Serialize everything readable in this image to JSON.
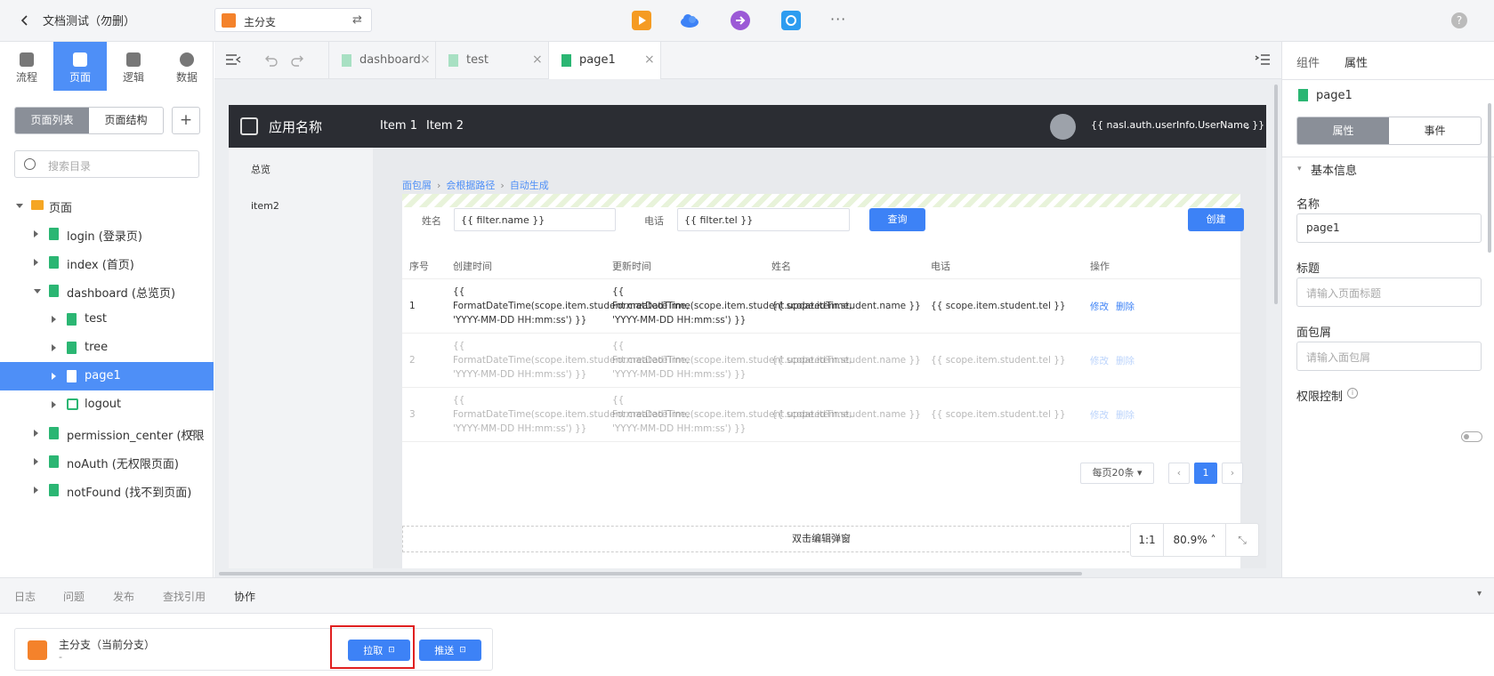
{
  "topbar": {
    "title": "文档测试（勿删）",
    "branch": "主分支",
    "switch_glyph": "⇄",
    "more": "···",
    "help": "?",
    "tools": [
      {
        "name": "play-icon",
        "color": "#f59b23"
      },
      {
        "name": "cloud-icon",
        "color": "#3d82f6"
      },
      {
        "name": "forward-icon",
        "color": "#9b59d6"
      },
      {
        "name": "sync-icon",
        "color": "#2d9cf0"
      }
    ]
  },
  "nav": {
    "tabs": [
      {
        "label": "流程",
        "active": false
      },
      {
        "label": "页面",
        "active": true
      },
      {
        "label": "逻辑",
        "active": false
      },
      {
        "label": "数据",
        "active": false
      }
    ],
    "segment": [
      "页面列表",
      "页面结构"
    ],
    "add": "+",
    "search_placeholder": "搜索目录"
  },
  "tree": [
    {
      "label": "页面",
      "kind": "folder",
      "open": true,
      "depth": 0
    },
    {
      "label": "login (登录页)",
      "kind": "page",
      "open": false,
      "depth": 1
    },
    {
      "label": "index (首页)",
      "kind": "page",
      "open": false,
      "depth": 1
    },
    {
      "label": "dashboard (总览页)",
      "kind": "page",
      "open": true,
      "depth": 1
    },
    {
      "label": "test",
      "kind": "page",
      "open": false,
      "depth": 2
    },
    {
      "label": "tree",
      "kind": "page",
      "open": false,
      "depth": 2
    },
    {
      "label": "page1",
      "kind": "page",
      "open": false,
      "depth": 2,
      "selected": true
    },
    {
      "label": "logout",
      "kind": "logic",
      "open": false,
      "depth": 2
    },
    {
      "label": "permission_center (权限",
      "kind": "page",
      "open": false,
      "depth": 1,
      "home": true
    },
    {
      "label": "noAuth (无权限页面)",
      "kind": "page",
      "open": false,
      "depth": 1
    },
    {
      "label": "notFound (找不到页面)",
      "kind": "page",
      "open": false,
      "depth": 1
    }
  ],
  "editor_tabs": [
    {
      "label": "dashboard",
      "active": false
    },
    {
      "label": "test",
      "active": false
    },
    {
      "label": "page1",
      "active": true
    }
  ],
  "preview": {
    "app_name": "应用名称",
    "menu": [
      "Item 1",
      "Item 2"
    ],
    "user": "{{ nasl.auth.userInfo.UserName }}",
    "side": [
      "总览",
      "item2"
    ],
    "breadcrumb": [
      "面包屑",
      "会根据路径",
      "自动生成"
    ],
    "filter": {
      "name_label": "姓名",
      "name_value": "{{ filter.name }}",
      "tel_label": "电话",
      "tel_value": "{{ filter.tel }}",
      "query": "查询",
      "create": "创建"
    },
    "columns": [
      "序号",
      "创建时间",
      "更新时间",
      "姓名",
      "电话",
      "操作"
    ],
    "rows": [
      {
        "no": "1",
        "created": "{{ FormatDateTime(scope.item.student.createdTime, 'YYYY-MM-DD HH:mm:ss') }}",
        "updated": "{{ FormatDateTime(scope.item.student.updatedTime, 'YYYY-MM-DD HH:mm:ss') }}",
        "name": "{{ scope.item.student.name }}",
        "tel": "{{ scope.item.student.tel }}"
      },
      {
        "no": "2",
        "created": "{{ FormatDateTime(scope.item.student.createdTime, 'YYYY-MM-DD HH:mm:ss') }}",
        "updated": "{{ FormatDateTime(scope.item.student.updatedTime, 'YYYY-MM-DD HH:mm:ss') }}",
        "name": "{{ scope.item.student.name }}",
        "tel": "{{ scope.item.student.tel }}"
      },
      {
        "no": "3",
        "created": "{{ FormatDateTime(scope.item.student.createdTime, 'YYYY-MM-DD HH:mm:ss') }}",
        "updated": "{{ FormatDateTime(scope.item.student.updatedTime, 'YYYY-MM-DD HH:mm:ss') }}",
        "name": "{{ scope.item.student.name }}",
        "tel": "{{ scope.item.student.tel }}"
      }
    ],
    "edit": "修改",
    "delete": "删除",
    "page_size": "每页20条",
    "page": "1",
    "modal_hint": "双击编辑弹窗"
  },
  "zoom": {
    "ratio": "1:1",
    "level": "80.9%"
  },
  "right": {
    "tabs": [
      "组件",
      "属性"
    ],
    "page_name": "page1",
    "segment": [
      "属性",
      "事件"
    ],
    "section": "基本信息",
    "name_label": "名称",
    "name_value": "page1",
    "title_label": "标题",
    "title_placeholder": "请输入页面标题",
    "crumb_label": "面包屑",
    "crumb_placeholder": "请输入面包屑",
    "perm_label": "权限控制"
  },
  "bottom": {
    "tabs": [
      "日志",
      "问题",
      "发布",
      "查找引用",
      "协作"
    ],
    "active_tab": "协作",
    "branch_title": "主分支（当前分支）",
    "branch_sub": "-",
    "pull": "拉取",
    "push": "推送"
  }
}
